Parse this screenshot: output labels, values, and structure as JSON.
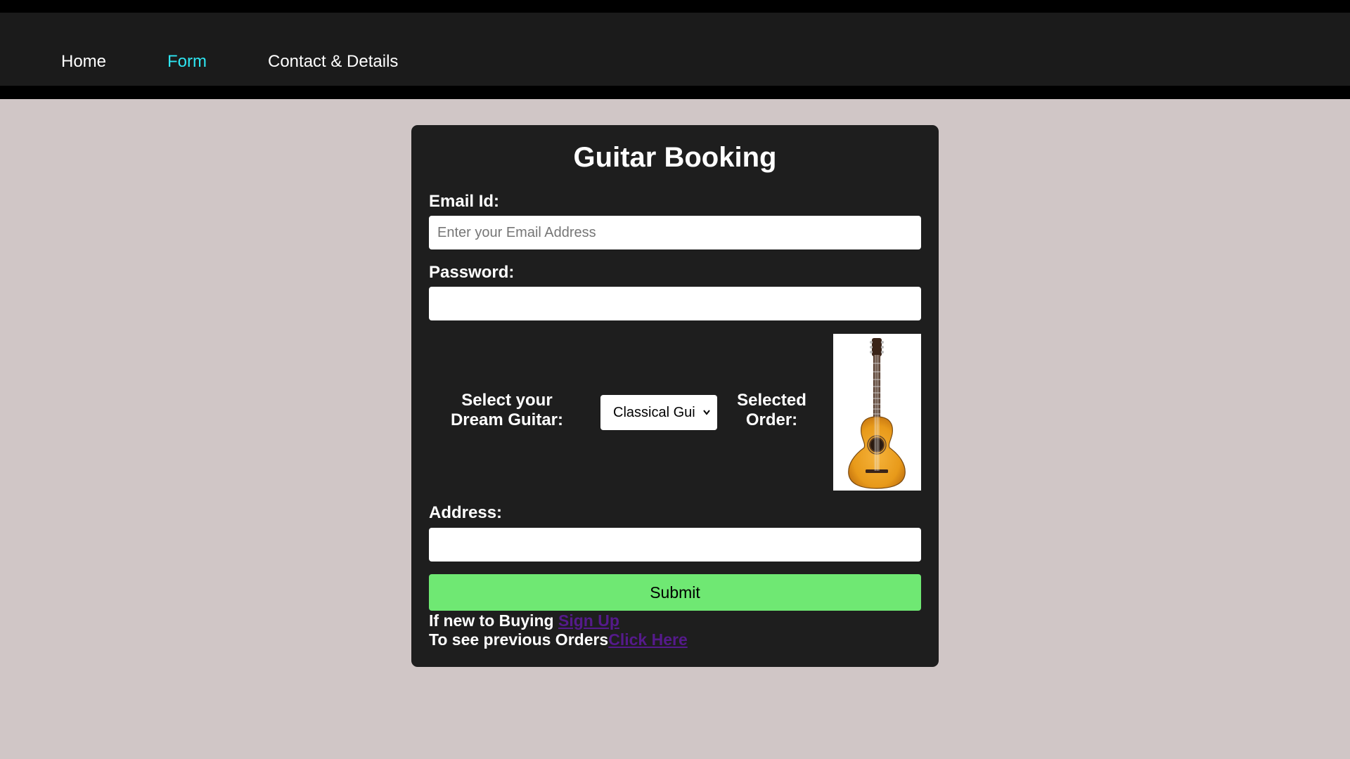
{
  "nav": {
    "items": [
      {
        "label": "Home"
      },
      {
        "label": "Form"
      },
      {
        "label": "Contact & Details"
      }
    ]
  },
  "form": {
    "title": "Guitar Booking",
    "email_label": "Email Id:",
    "email_placeholder": "Enter your Email Address",
    "email_value": "",
    "password_label": "Password:",
    "password_value": "",
    "guitar_label": "Select your Dream Guitar:",
    "guitar_selected": "Classical Guitar",
    "guitar_selected_visible": "Classical Gui",
    "selected_order_label": "Selected Order:",
    "selected_order_image": "classical-guitar-image",
    "address_label": "Address:",
    "address_value": "",
    "submit_label": "Submit",
    "signup_prompt": "If new to Buying ",
    "signup_link": "Sign Up",
    "orders_prompt": "To see previous Orders",
    "orders_link": "Click Here"
  },
  "colors": {
    "nav_active": "#2ee6f2",
    "submit_bg": "#6fe873",
    "link": "#551a8b",
    "page_bg": "#d0c6c6",
    "card_bg": "#1e1e1e"
  }
}
